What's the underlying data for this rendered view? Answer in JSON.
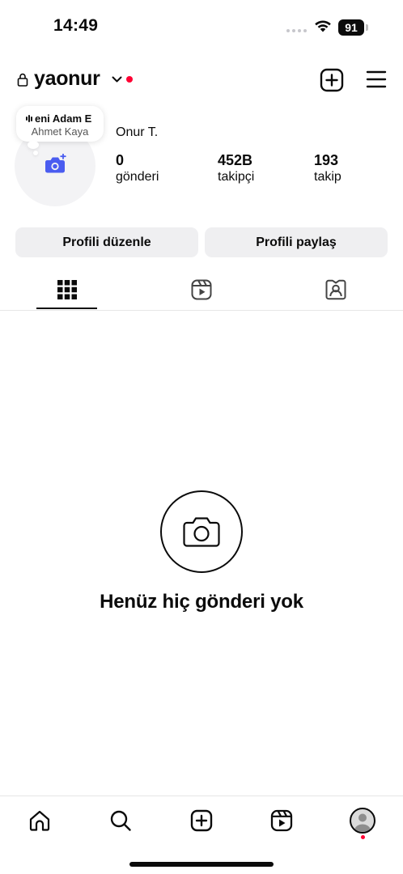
{
  "status_bar": {
    "time": "14:49",
    "battery": "91"
  },
  "header": {
    "username": "yaonur"
  },
  "note": {
    "song": "eni Adam E",
    "artist": "Ahmet Kaya"
  },
  "profile": {
    "display_name": "Onur T.",
    "stats": [
      {
        "value": "0",
        "label": "gönderi"
      },
      {
        "value": "452B",
        "label": "takipçi"
      },
      {
        "value": "193",
        "label": "takip"
      }
    ]
  },
  "actions": {
    "edit_label": "Profili düzenle",
    "share_label": "Profili paylaş"
  },
  "tabs": [
    {
      "icon": "grid-icon",
      "active": true
    },
    {
      "icon": "reels-icon",
      "active": false
    },
    {
      "icon": "tagged-icon",
      "active": false
    }
  ],
  "empty_state": {
    "title": "Henüz hiç gönderi yok"
  },
  "bottom_nav": [
    "home-icon",
    "search-icon",
    "create-icon",
    "reels-icon",
    "profile-avatar"
  ],
  "colors": {
    "accent": "#4a5cf0",
    "notification": "#ff0033",
    "button_bg": "#efeff1"
  }
}
